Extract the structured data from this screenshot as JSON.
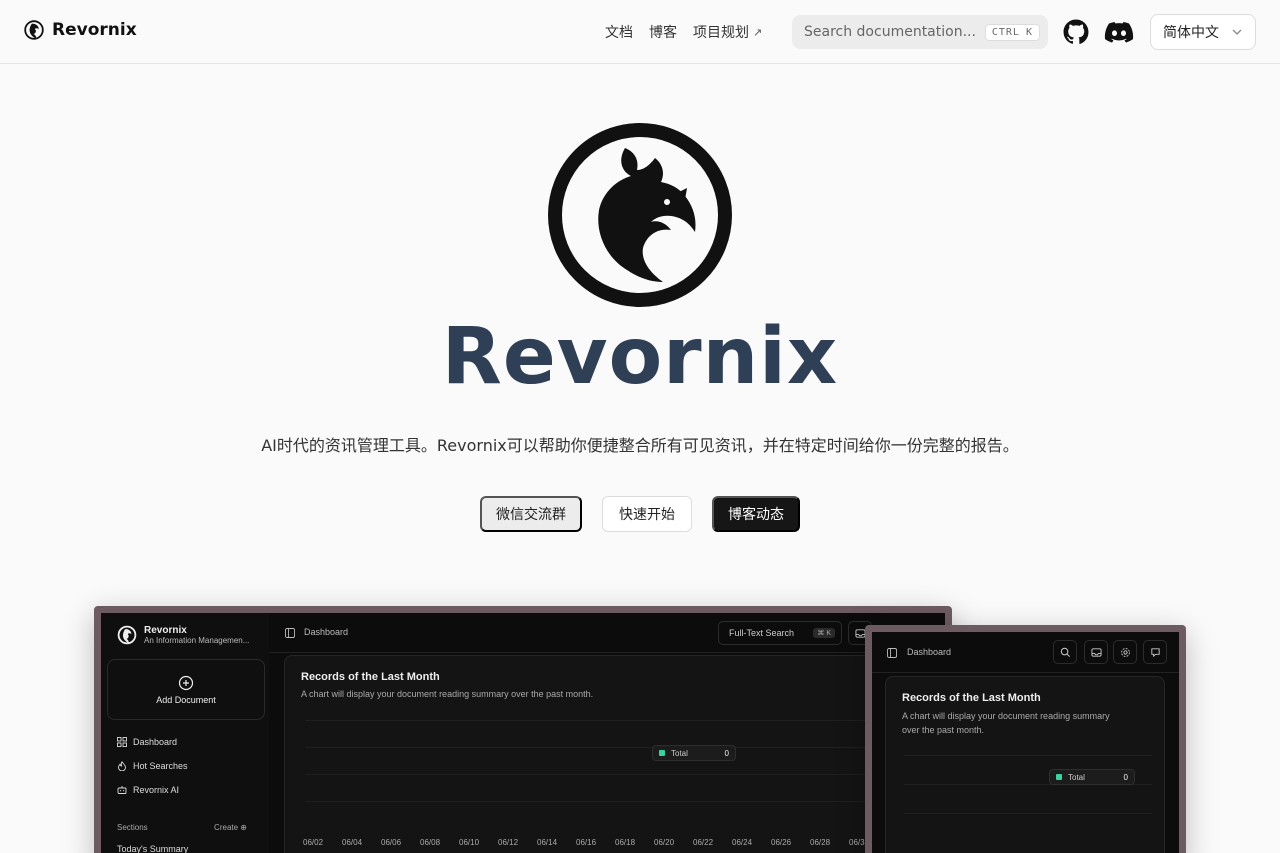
{
  "brand": {
    "name": "Revornix"
  },
  "nav": {
    "links": [
      {
        "label": "文档",
        "external": false
      },
      {
        "label": "博客",
        "external": false
      },
      {
        "label": "项目规划",
        "external": true
      }
    ],
    "search": {
      "placeholder": "Search documentation...",
      "shortcut_mod": "CTRL",
      "shortcut_key": "K"
    },
    "language": "简体中文"
  },
  "hero": {
    "title": "Revornix",
    "subtitle": "AI时代的资讯管理工具。Revornix可以帮助你便捷整合所有可见资讯，并在特定时间给你一份完整的报告。",
    "buttons": {
      "wechat": "微信交流群",
      "start": "快速开始",
      "blog": "博客动态"
    }
  },
  "app_preview": {
    "sidebar": {
      "title": "Revornix",
      "subtitle": "An Information Managemen...",
      "add_document": "Add Document",
      "items": [
        "Dashboard",
        "Hot Searches",
        "Revornix AI"
      ],
      "sections_label": "Sections",
      "create_label": "Create",
      "today": "Today's Summary"
    },
    "header": {
      "title": "Dashboard",
      "search_label": "Full-Text Search",
      "search_kbd": "⌘ K"
    },
    "card": {
      "title": "Records of the Last Month",
      "description": "A chart will display your document reading summary over the past month.",
      "description_narrow_1": "A chart will display your document reading summary",
      "description_narrow_2": "over the past month.",
      "tooltip_label": "Total",
      "tooltip_value": "0",
      "series_color": "#3ad29f"
    },
    "xticks": [
      "06/02",
      "06/04",
      "06/06",
      "06/08",
      "06/10",
      "06/12",
      "06/14",
      "06/16",
      "06/18",
      "06/20",
      "06/22",
      "06/24",
      "06/26",
      "06/28",
      "06/3"
    ]
  },
  "colors": {
    "hero_title": "#2f3f56",
    "primary_button": "#161616",
    "frame": "#6e5b62"
  }
}
